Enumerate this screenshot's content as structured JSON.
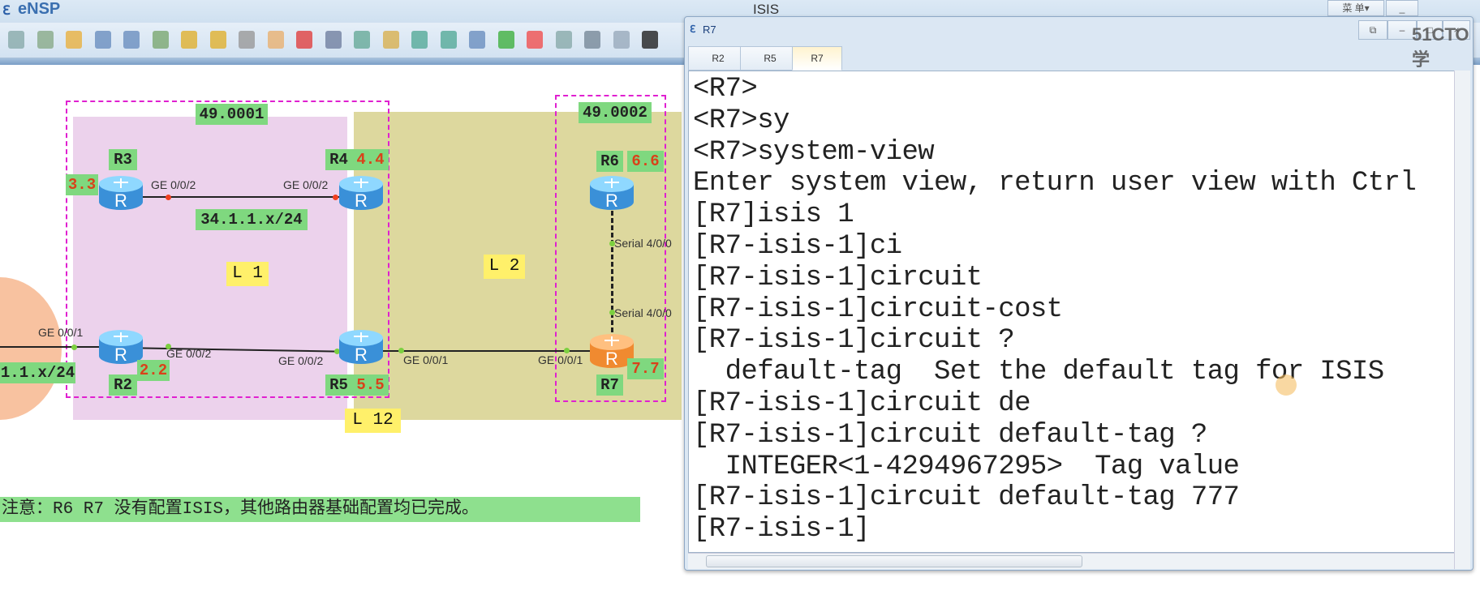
{
  "app": {
    "title": "eNSP",
    "topology_name": "ISIS",
    "watermark": "51CTO学"
  },
  "toolbar": {
    "icons": [
      "new-topology-icon",
      "new-blank-icon",
      "open-icon",
      "save-icon",
      "save-as-icon",
      "print-icon",
      "undo-icon",
      "redo-icon",
      "select-icon",
      "pan-icon",
      "delete-icon",
      "delete-link-icon",
      "text-icon",
      "palette-icon",
      "zoom-in-icon",
      "zoom-out-icon",
      "fit-icon",
      "start-icon",
      "stop-icon",
      "capture-icon",
      "topology-icon",
      "window-icon",
      "cli-icon"
    ]
  },
  "diagram": {
    "areas": [
      {
        "id": "49.0001"
      },
      {
        "id": "49.0002"
      }
    ],
    "levels": {
      "l1": "L 1",
      "l2": "L 2",
      "l12": "L 12"
    },
    "routers": [
      {
        "name": "R3",
        "loopback": "3.3",
        "color": "blue"
      },
      {
        "name": "R4",
        "loopback": "4.4",
        "color": "blue"
      },
      {
        "name": "R2",
        "loopback": "2.2",
        "color": "blue"
      },
      {
        "name": "R5",
        "loopback": "5.5",
        "color": "blue"
      },
      {
        "name": "R6",
        "loopback": "6.6",
        "color": "blue"
      },
      {
        "name": "R7",
        "loopback": "7.7",
        "color": "orange"
      }
    ],
    "subnets": {
      "r3_r4": "34.1.1.x/24",
      "left": "1.1.x/24"
    },
    "ports": {
      "r3": "GE 0/0/2",
      "r4": "GE 0/0/2",
      "r2_left": "GE 0/0/1",
      "r2_right": "GE 0/0/2",
      "r5_left": "GE 0/0/2",
      "r5_right": "GE 0/0/1",
      "r7_left": "GE 0/0/1",
      "r6_s": "Serial 4/0/0",
      "r7_s": "Serial 4/0/0"
    },
    "note": "注意：R6 R7 没有配置ISIS，其他路由器基础配置均已完成。",
    "colors": {
      "l1_region": "#ecd2ec",
      "l2_region": "#ddd89e",
      "area_border": "#e020d0",
      "label_bg": "#7fd87f",
      "level_bg": "#fff06a"
    }
  },
  "console": {
    "title": "R7",
    "tabs": [
      {
        "label": "R2"
      },
      {
        "label": "R5"
      },
      {
        "label": "R7",
        "active": true
      }
    ],
    "top_buttons": {
      "menu": "菜 单▾"
    },
    "lines": [
      "<R7>",
      "<R7>sy",
      "<R7>system-view",
      "Enter system view, return user view with Ctrl",
      "[R7]isis 1",
      "[R7-isis-1]ci",
      "[R7-isis-1]circuit",
      "[R7-isis-1]circuit-cost",
      "[R7-isis-1]circuit ?",
      "  default-tag  Set the default tag for ISIS",
      "[R7-isis-1]circuit de",
      "[R7-isis-1]circuit default-tag ?",
      "  INTEGER<1-4294967295>  Tag value",
      "[R7-isis-1]circuit default-tag 777",
      "[R7-isis-1]"
    ]
  }
}
